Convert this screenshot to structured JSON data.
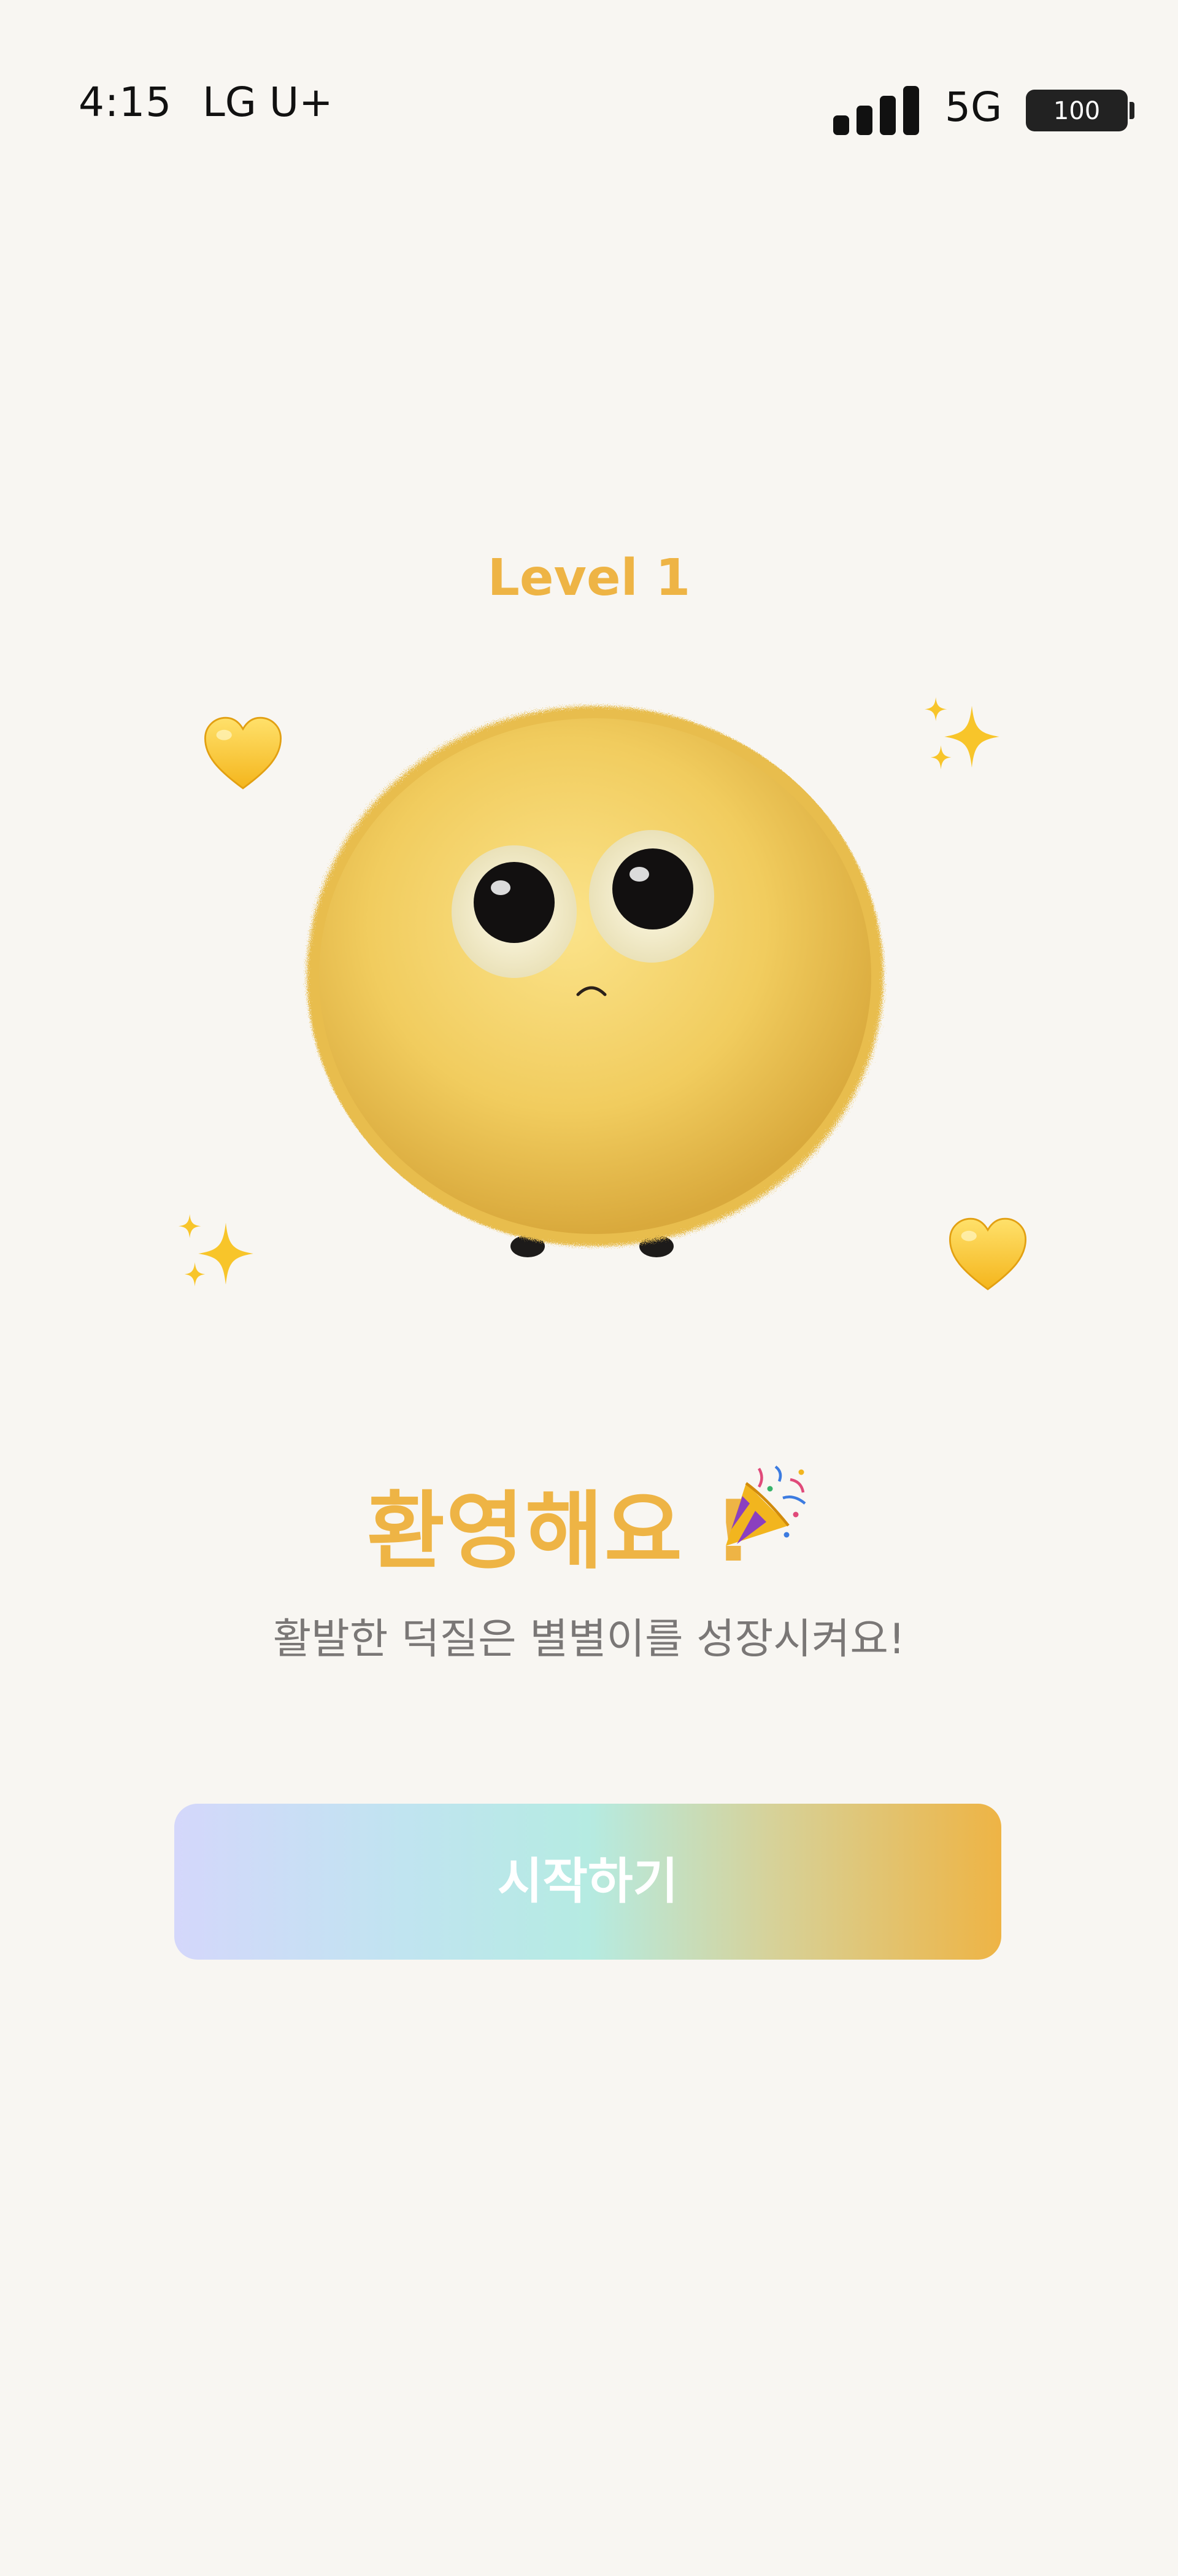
{
  "status_bar": {
    "time": "4:15",
    "carrier": "LG U+",
    "network": "5G",
    "battery": "100"
  },
  "level_label": "Level 1",
  "welcome": {
    "title": "환영해요 !",
    "subtitle": "활발한 덕질은 별별이를 성장시켜요!"
  },
  "start_button": {
    "label": "시작하기"
  },
  "colors": {
    "accent": "#eeb445",
    "background": "#f8f6f2",
    "subtitle": "#7a7776",
    "gradient": [
      "#d4d7fb",
      "#b5ebe2",
      "#eeb445"
    ]
  },
  "icons": [
    "signal-icon",
    "battery-icon",
    "yellow-heart-icon",
    "sparkles-icon",
    "party-popper-icon"
  ]
}
